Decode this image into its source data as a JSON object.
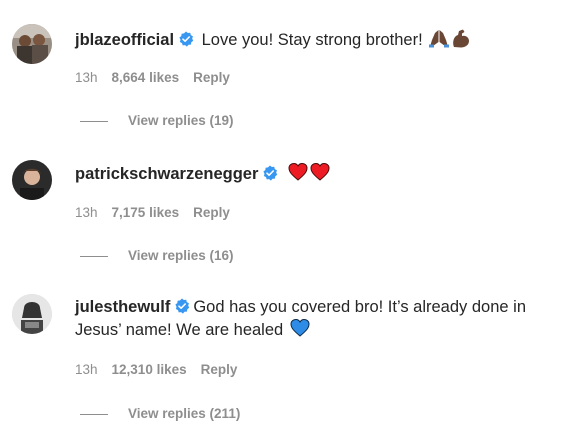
{
  "comments": [
    {
      "username": "jblazeofficial",
      "text": "Love you! Stay strong brother!",
      "emojis": [
        "folded-hands",
        "flexed-biceps"
      ],
      "time": "13h",
      "likes": "8,664 likes",
      "reply": "Reply",
      "view_replies": "View replies (19)"
    },
    {
      "username": "patrickschwarzenegger",
      "text": "",
      "emojis": [
        "red-heart",
        "red-heart"
      ],
      "time": "13h",
      "likes": "7,175 likes",
      "reply": "Reply",
      "view_replies": "View replies (16)"
    },
    {
      "username": "julesthewulf",
      "text_line1": "God has you covered bro! It’s already done in",
      "text_line2": "Jesus’ name! We are healed",
      "emojis": [
        "blue-heart"
      ],
      "time": "13h",
      "likes": "12,310 likes",
      "reply": "Reply",
      "view_replies": "View replies (211)"
    }
  ],
  "colors": {
    "username": "#262626",
    "text": "#262626",
    "meta": "#8e8e8e",
    "verified": "#3897f0",
    "heart_red": "#ed1c24",
    "heart_blue": "#2e8ce6"
  }
}
